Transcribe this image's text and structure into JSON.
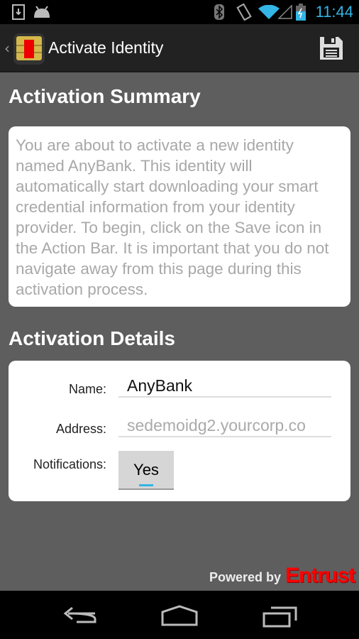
{
  "status_bar": {
    "time": "11:44",
    "icons": [
      "download-icon",
      "android-icon",
      "bluetooth-icon",
      "vibrate-icon",
      "wifi-icon",
      "signal-icon",
      "battery-charging-icon"
    ]
  },
  "action_bar": {
    "title": "Activate Identity",
    "save_icon": "save-icon"
  },
  "summary": {
    "heading": "Activation Summary",
    "text": "You are about to activate a new identity named AnyBank. This identity will automatically start downloading your smart credential information from your identity provider. To begin, click on the Save icon in the Action Bar. It is important that you do not navigate away from this page during this activation process."
  },
  "details": {
    "heading": "Activation Details",
    "name_label": "Name:",
    "name_value": "AnyBank",
    "address_label": "Address:",
    "address_value": "sedemoidg2.yourcorp.co",
    "notifications_label": "Notifications:",
    "notifications_value": "Yes"
  },
  "footer": {
    "powered_by": "Powered by",
    "brand": "Entrust"
  },
  "colors": {
    "accent": "#33b5e5",
    "brand": "#ff0000"
  }
}
